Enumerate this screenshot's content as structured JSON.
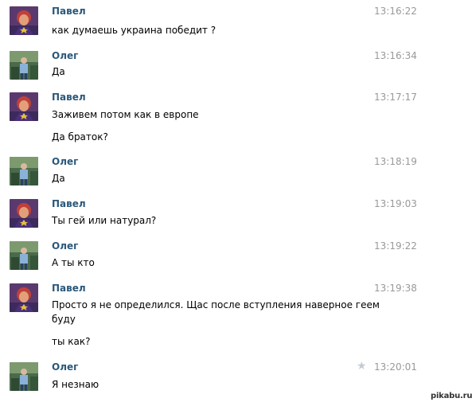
{
  "messages": [
    {
      "sender": "Павел",
      "time": "13:16:22",
      "lines": [
        "как думаешь украина победит ?"
      ],
      "avatar": "pavel"
    },
    {
      "sender": "Олег",
      "time": "13:16:34",
      "lines": [
        "Да"
      ],
      "avatar": "oleg"
    },
    {
      "sender": "Павел",
      "time": "13:17:17",
      "lines": [
        "Заживем потом как в европе",
        "Да браток?"
      ],
      "avatar": "pavel"
    },
    {
      "sender": "Олег",
      "time": "13:18:19",
      "lines": [
        "Да"
      ],
      "avatar": "oleg"
    },
    {
      "sender": "Павел",
      "time": "13:19:03",
      "lines": [
        "Ты гей или натурал?"
      ],
      "avatar": "pavel"
    },
    {
      "sender": "Олег",
      "time": "13:19:22",
      "lines": [
        "А ты кто"
      ],
      "avatar": "oleg"
    },
    {
      "sender": "Павел",
      "time": "13:19:38",
      "lines": [
        "Просто я не определился. Щас после вступления наверное геем",
        "буду",
        "ты как?"
      ],
      "avatar": "pavel"
    },
    {
      "sender": "Олег",
      "time": "13:20:01",
      "lines": [
        "Я незнаю"
      ],
      "avatar": "oleg",
      "starred": true
    }
  ],
  "watermark": "pikabu.ru",
  "colors": {
    "sender_name": "#2b587a",
    "timestamp": "#999999",
    "star": "#c4cbd3"
  },
  "icons": {
    "star": "star-icon",
    "avatar_pavel": "avatar-pavel",
    "avatar_oleg": "avatar-oleg"
  }
}
